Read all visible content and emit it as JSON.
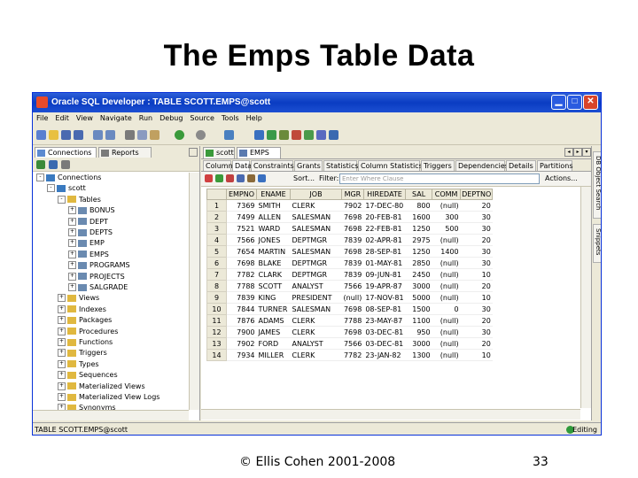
{
  "slide": {
    "title": "The Emps Table Data",
    "copyright": "© Ellis Cohen 2001-2008",
    "page_number": "33"
  },
  "window": {
    "title": "Oracle SQL Developer : TABLE SCOTT.EMPS@scott",
    "menu": [
      "File",
      "Edit",
      "View",
      "Navigate",
      "Run",
      "Debug",
      "Source",
      "Tools",
      "Help"
    ]
  },
  "left_panel": {
    "tabs": [
      "Connections",
      "Reports"
    ],
    "tree": [
      {
        "label": "Connections",
        "indent": 0,
        "icon": "db",
        "toggle": "-"
      },
      {
        "label": "scott",
        "indent": 1,
        "icon": "db",
        "toggle": "-"
      },
      {
        "label": "Tables",
        "indent": 2,
        "icon": "folder",
        "toggle": "-"
      },
      {
        "label": "BONUS",
        "indent": 3,
        "icon": "table",
        "toggle": "+"
      },
      {
        "label": "DEPT",
        "indent": 3,
        "icon": "table",
        "toggle": "+"
      },
      {
        "label": "DEPTS",
        "indent": 3,
        "icon": "table",
        "toggle": "+"
      },
      {
        "label": "EMP",
        "indent": 3,
        "icon": "table",
        "toggle": "+"
      },
      {
        "label": "EMPS",
        "indent": 3,
        "icon": "table",
        "toggle": "+"
      },
      {
        "label": "PROGRAMS",
        "indent": 3,
        "icon": "table",
        "toggle": "+"
      },
      {
        "label": "PROJECTS",
        "indent": 3,
        "icon": "table",
        "toggle": "+"
      },
      {
        "label": "SALGRADE",
        "indent": 3,
        "icon": "table",
        "toggle": "+"
      },
      {
        "label": "Views",
        "indent": 2,
        "icon": "folder",
        "toggle": "+"
      },
      {
        "label": "Indexes",
        "indent": 2,
        "icon": "folder",
        "toggle": "+"
      },
      {
        "label": "Packages",
        "indent": 2,
        "icon": "folder",
        "toggle": "+"
      },
      {
        "label": "Procedures",
        "indent": 2,
        "icon": "folder",
        "toggle": "+"
      },
      {
        "label": "Functions",
        "indent": 2,
        "icon": "folder",
        "toggle": "+"
      },
      {
        "label": "Triggers",
        "indent": 2,
        "icon": "folder",
        "toggle": "+"
      },
      {
        "label": "Types",
        "indent": 2,
        "icon": "folder",
        "toggle": "+"
      },
      {
        "label": "Sequences",
        "indent": 2,
        "icon": "folder",
        "toggle": "+"
      },
      {
        "label": "Materialized Views",
        "indent": 2,
        "icon": "folder",
        "toggle": "+"
      },
      {
        "label": "Materialized View Logs",
        "indent": 2,
        "icon": "folder",
        "toggle": "+"
      },
      {
        "label": "Synonyms",
        "indent": 2,
        "icon": "folder",
        "toggle": "+"
      }
    ]
  },
  "editor": {
    "doc_tabs": [
      "scott",
      "EMPS"
    ],
    "sub_tabs": [
      "Columns",
      "Data",
      "Constraints",
      "Grants",
      "Statistics",
      "Column Statistics",
      "Triggers",
      "Dependencies",
      "Details",
      "Partitions"
    ],
    "sort_label": "Sort...",
    "filter_label": "Filter:",
    "filter_placeholder": "Enter Where Clause",
    "actions_label": "Actions...",
    "columns": [
      "EMPNO",
      "ENAME",
      "JOB",
      "MGR",
      "HIREDATE",
      "SAL",
      "COMM",
      "DEPTNO"
    ],
    "rows": [
      [
        "1",
        "7369",
        "SMITH",
        "CLERK",
        "7902",
        "17-DEC-80",
        "800",
        "(null)",
        "20"
      ],
      [
        "2",
        "7499",
        "ALLEN",
        "SALESMAN",
        "7698",
        "20-FEB-81",
        "1600",
        "300",
        "30"
      ],
      [
        "3",
        "7521",
        "WARD",
        "SALESMAN",
        "7698",
        "22-FEB-81",
        "1250",
        "500",
        "30"
      ],
      [
        "4",
        "7566",
        "JONES",
        "DEPTMGR",
        "7839",
        "02-APR-81",
        "2975",
        "(null)",
        "20"
      ],
      [
        "5",
        "7654",
        "MARTIN",
        "SALESMAN",
        "7698",
        "28-SEP-81",
        "1250",
        "1400",
        "30"
      ],
      [
        "6",
        "7698",
        "BLAKE",
        "DEPTMGR",
        "7839",
        "01-MAY-81",
        "2850",
        "(null)",
        "30"
      ],
      [
        "7",
        "7782",
        "CLARK",
        "DEPTMGR",
        "7839",
        "09-JUN-81",
        "2450",
        "(null)",
        "10"
      ],
      [
        "8",
        "7788",
        "SCOTT",
        "ANALYST",
        "7566",
        "19-APR-87",
        "3000",
        "(null)",
        "20"
      ],
      [
        "9",
        "7839",
        "KING",
        "PRESIDENT",
        "(null)",
        "17-NOV-81",
        "5000",
        "(null)",
        "10"
      ],
      [
        "10",
        "7844",
        "TURNER",
        "SALESMAN",
        "7698",
        "08-SEP-81",
        "1500",
        "0",
        "30"
      ],
      [
        "11",
        "7876",
        "ADAMS",
        "CLERK",
        "7788",
        "23-MAY-87",
        "1100",
        "(null)",
        "20"
      ],
      [
        "12",
        "7900",
        "JAMES",
        "CLERK",
        "7698",
        "03-DEC-81",
        "950",
        "(null)",
        "30"
      ],
      [
        "13",
        "7902",
        "FORD",
        "ANALYST",
        "7566",
        "03-DEC-81",
        "3000",
        "(null)",
        "20"
      ],
      [
        "14",
        "7934",
        "MILLER",
        "CLERK",
        "7782",
        "23-JAN-82",
        "1300",
        "(null)",
        "10"
      ]
    ]
  },
  "right_bar": {
    "tabs": [
      "DB Object Search",
      "Snippets"
    ]
  },
  "status": {
    "left": "TABLE SCOTT.EMPS@scott",
    "right": "Editing"
  },
  "colors": {
    "titlebar": "#0a3cc2",
    "chrome": "#ece9d8",
    "accent": "#0831d9"
  }
}
